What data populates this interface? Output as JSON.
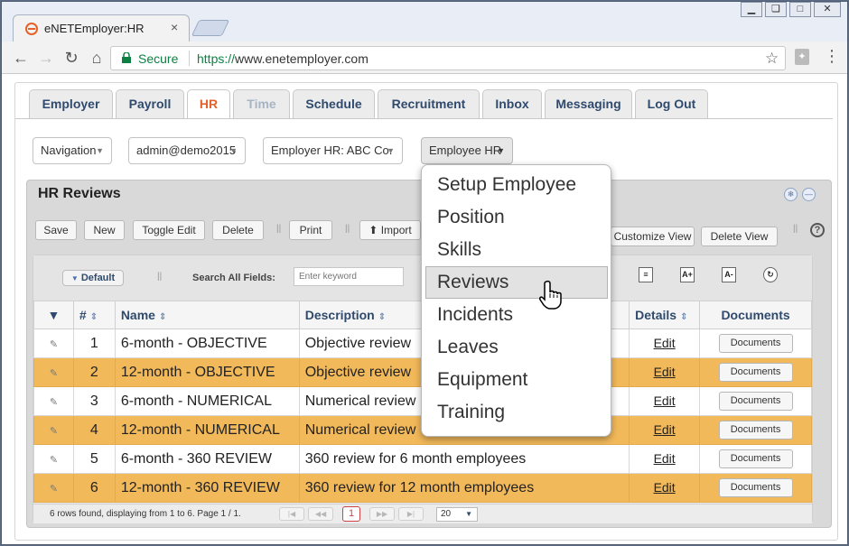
{
  "browser": {
    "tab_title": "eNETEmployer:HR",
    "secure_label": "Secure",
    "url_protocol": "https://",
    "url_host": "www.enetemployer.com",
    "tab_close_glyph": "×"
  },
  "main_tabs": [
    {
      "label": "Employer"
    },
    {
      "label": "Payroll"
    },
    {
      "label": "HR"
    },
    {
      "label": "Time"
    },
    {
      "label": "Schedule"
    },
    {
      "label": "Recruitment"
    },
    {
      "label": "Inbox"
    },
    {
      "label": "Messaging"
    },
    {
      "label": "Log Out"
    }
  ],
  "selectors": {
    "navigation": "Navigation",
    "user": "admin@demo2015",
    "employer": "Employer HR: ABC Co.",
    "employee": "Employee HR"
  },
  "panel": {
    "title": "HR Reviews",
    "buttons": {
      "save": "Save",
      "new": "New",
      "toggle_edit": "Toggle Edit",
      "delete": "Delete",
      "print": "Print",
      "import": "Import",
      "customize_view": "Customize View",
      "delete_view": "Delete View"
    },
    "view_default": "Default",
    "search_label": "Search All Fields:",
    "search_placeholder": "Enter keyword"
  },
  "table": {
    "headers": {
      "num": "#",
      "name": "Name",
      "description": "Description",
      "details": "Details",
      "documents": "Documents"
    },
    "rows": [
      {
        "num": "1",
        "name": "6-month - OBJECTIVE",
        "description": "Objective review",
        "edit": "Edit",
        "doc": "Documents"
      },
      {
        "num": "2",
        "name": "12-month - OBJECTIVE",
        "description": "Objective review",
        "edit": "Edit",
        "doc": "Documents"
      },
      {
        "num": "3",
        "name": "6-month - NUMERICAL",
        "description": "Numerical review",
        "edit": "Edit",
        "doc": "Documents"
      },
      {
        "num": "4",
        "name": "12-month - NUMERICAL",
        "description": "Numerical review",
        "edit": "Edit",
        "doc": "Documents"
      },
      {
        "num": "5",
        "name": "6-month - 360 REVIEW",
        "description": "360 review for 6 month employees",
        "edit": "Edit",
        "doc": "Documents"
      },
      {
        "num": "6",
        "name": "12-month - 360 REVIEW",
        "description": "360 review for 12 month employees",
        "edit": "Edit",
        "doc": "Documents"
      }
    ]
  },
  "pager": {
    "status": "6 rows found, displaying from 1 to 6. Page 1 / 1.",
    "current_page": "1",
    "page_size": "20"
  },
  "employee_menu": [
    {
      "label": "Setup Employee"
    },
    {
      "label": "Position"
    },
    {
      "label": "Skills"
    },
    {
      "label": "Reviews"
    },
    {
      "label": "Incidents"
    },
    {
      "label": "Leaves"
    },
    {
      "label": "Equipment"
    },
    {
      "label": "Training"
    }
  ],
  "colors": {
    "active_tab": "#e4612b",
    "row_highlight": "#f2b95a",
    "tab_text": "#2f4a6d"
  }
}
